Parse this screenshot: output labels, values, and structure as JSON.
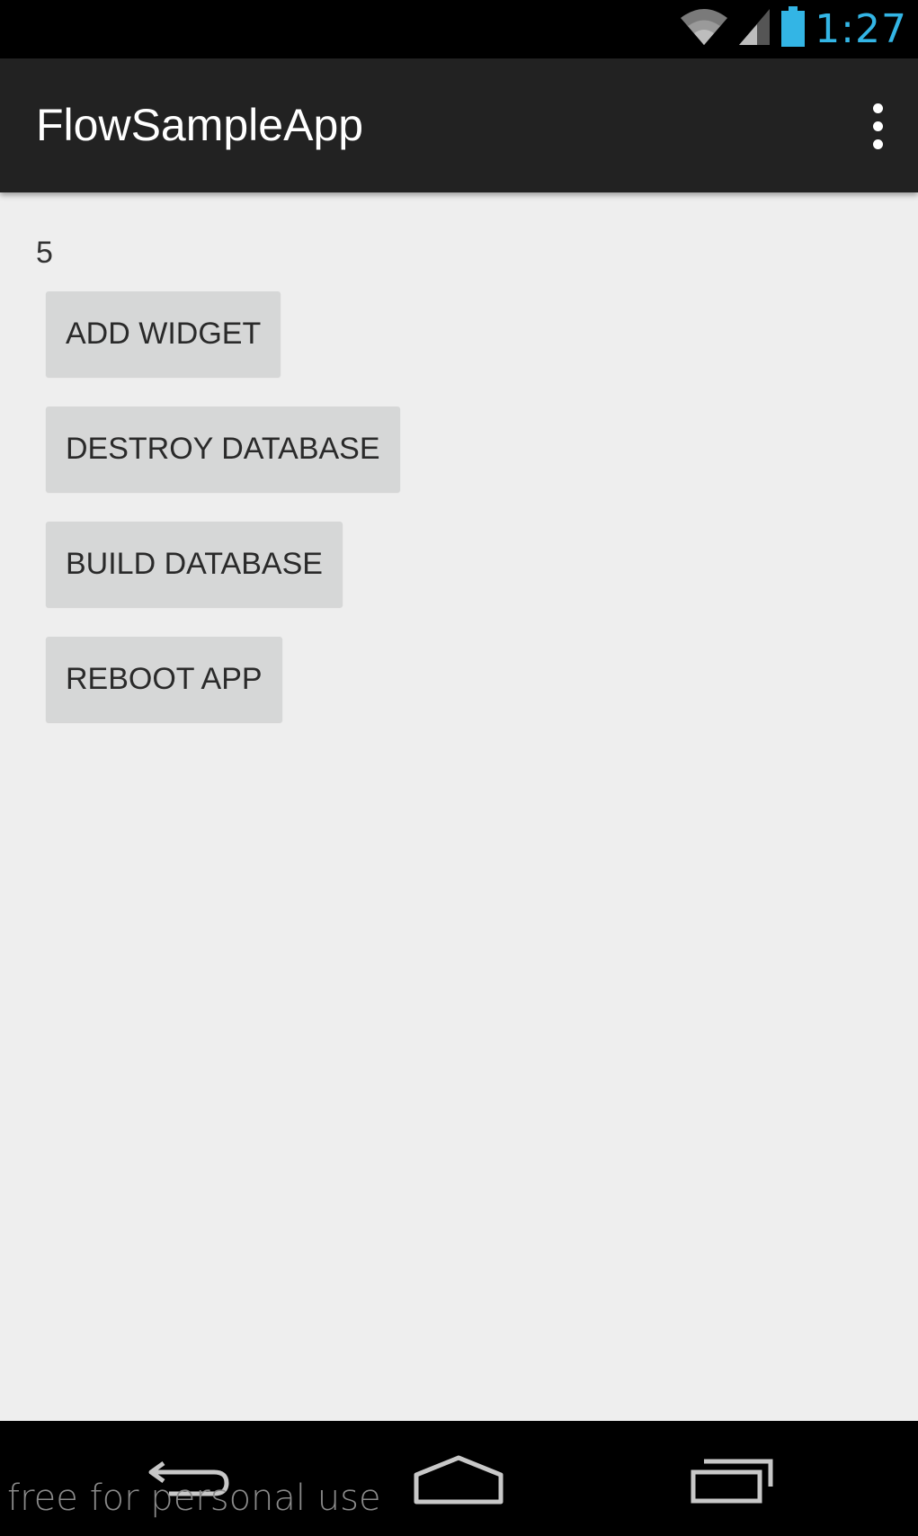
{
  "status_bar": {
    "time": "1:27",
    "icons": [
      "wifi-icon",
      "cell-signal-icon",
      "battery-icon"
    ],
    "accent_color": "#33b5e5"
  },
  "action_bar": {
    "title": "FlowSampleApp",
    "overflow_icon": "overflow-menu-icon"
  },
  "main": {
    "counter": "5",
    "buttons": [
      {
        "label": "ADD WIDGET"
      },
      {
        "label": "DESTROY DATABASE"
      },
      {
        "label": "BUILD DATABASE"
      },
      {
        "label": "REBOOT APP"
      }
    ]
  },
  "nav_bar": {
    "icons": [
      "back-icon",
      "home-icon",
      "recents-icon"
    ]
  },
  "watermark": "free for personal use"
}
